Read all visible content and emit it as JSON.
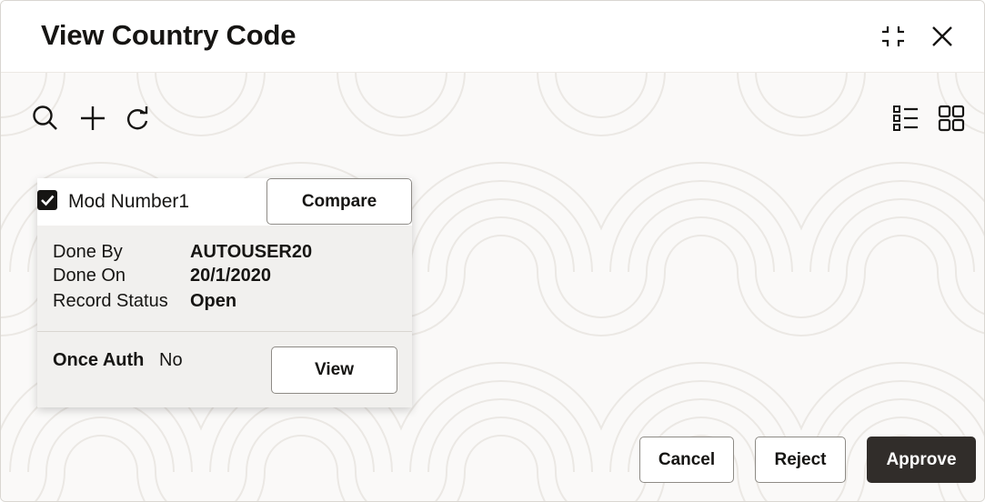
{
  "dialog": {
    "title": "View Country Code"
  },
  "header_icons": {
    "minimize": "minimize-icon",
    "close": "close-icon"
  },
  "toolbar": {
    "search": "search-icon",
    "add": "plus-icon",
    "refresh": "refresh-icon",
    "list_view": "list-view-icon",
    "grid_view": "grid-view-icon"
  },
  "card": {
    "checked": true,
    "mod_number_label": "Mod Number1",
    "compare_label": "Compare",
    "fields": [
      {
        "label": "Done By",
        "value": "AUTOUSER20"
      },
      {
        "label": "Done On",
        "value": "20/1/2020"
      },
      {
        "label": "Record Status",
        "value": "Open"
      }
    ],
    "once_auth_label": "Once Auth",
    "once_auth_value": "No",
    "view_label": "View"
  },
  "footer": {
    "cancel_label": "Cancel",
    "reject_label": "Reject",
    "approve_label": "Approve"
  },
  "colors": {
    "primary_button": "#312d2a",
    "background": "#faf9f8",
    "card_body": "#f1f0ee"
  }
}
